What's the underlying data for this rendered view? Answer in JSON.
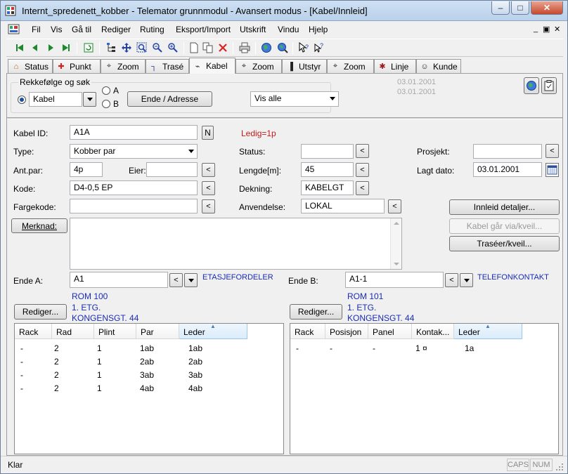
{
  "window": {
    "title": "Internt_spredenett_kobber - Telemator grunnmodul - Avansert modus - [Kabel/Innleid]",
    "min": "–",
    "max": "□",
    "close": "✕"
  },
  "menu": {
    "items": [
      "Fil",
      "Vis",
      "Gå til",
      "Rediger",
      "Ruting",
      "Eksport/Import",
      "Utskrift",
      "Vindu",
      "Hjelp"
    ],
    "mdi": {
      "min": "_",
      "restore": "▣",
      "close": "✕"
    }
  },
  "tabs": [
    {
      "label": "Status",
      "icon": "home-icon",
      "glyph": "⌂",
      "color": "#b06a00"
    },
    {
      "label": "Punkt",
      "icon": "cross-point-icon",
      "glyph": "✚",
      "color": "#cc2222"
    },
    {
      "label": "Zoom",
      "icon": "zoom-point-icon",
      "glyph": "⌖",
      "color": "#444444"
    },
    {
      "label": "Trasé",
      "icon": "route-icon",
      "glyph": "┐",
      "color": "#1b2f8a"
    },
    {
      "label": "Kabel",
      "icon": "cable-icon",
      "glyph": "⌁",
      "color": "#333333"
    },
    {
      "label": "Zoom",
      "icon": "zoom-cable-icon",
      "glyph": "⌖",
      "color": "#333333"
    },
    {
      "label": "Utstyr",
      "icon": "equipment-icon",
      "glyph": "▐",
      "color": "#222222"
    },
    {
      "label": "Zoom",
      "icon": "zoom-equipment-icon",
      "glyph": "⌖",
      "color": "#333333"
    },
    {
      "label": "Linje",
      "icon": "line-icon",
      "glyph": "✱",
      "color": "#a01818"
    },
    {
      "label": "Kunde",
      "icon": "customer-icon",
      "glyph": "☺",
      "color": "#222222"
    }
  ],
  "search": {
    "group_label": "Rekkefølge og søk",
    "order_value": "Kabel",
    "radio_a": "A",
    "radio_b": "B",
    "end_address_button": "Ende / Adresse",
    "filter_value": "Vis alle",
    "date1": "03.01.2001",
    "date2": "03.01.2001"
  },
  "form": {
    "kabel_id_label": "Kabel ID:",
    "kabel_id": "A1A",
    "n_button": "N",
    "ledig": "Ledig=1p",
    "type_label": "Type:",
    "type_value": "Kobber par",
    "status_label": "Status:",
    "status_value": "",
    "prosjekt_label": "Prosjekt:",
    "prosjekt_value": "",
    "antpar_label": "Ant.par:",
    "antpar_value": "4p",
    "eier_label": "Eier:",
    "eier_value": "",
    "lengde_label": "Lengde[m]:",
    "lengde_value": "45",
    "lagt_dato_label": "Lagt dato:",
    "lagt_dato_value": "03.01.2001",
    "kode_label": "Kode:",
    "kode_value": "D4-0,5 EP",
    "dekning_label": "Dekning:",
    "dekning_value": "KABELGT",
    "fargekode_label": "Fargekode:",
    "fargekode_value": "",
    "anvendelse_label": "Anvendelse:",
    "anvendelse_value": "LOKAL",
    "innleid_button": "Innleid detaljer...",
    "merknad_button": "Merknad:",
    "merknad_value": "",
    "kabel_via_button": "Kabel går via/kveil...",
    "traseer_button": "Traséer/kveil...",
    "arrow": "<"
  },
  "ende_a": {
    "label": "Ende A:",
    "value": "A1",
    "type": "ETASJEFORDELER",
    "addr": [
      "ROM 100",
      "1. ETG.",
      "KONGENSGT. 44"
    ],
    "edit_button": "Rediger...",
    "columns": [
      "Rack",
      "Rad",
      "Plint",
      "Par",
      "Leder"
    ],
    "rows": [
      [
        "-",
        "2",
        "1",
        "1ab",
        "1ab"
      ],
      [
        "-",
        "2",
        "1",
        "2ab",
        "2ab"
      ],
      [
        "-",
        "2",
        "1",
        "3ab",
        "3ab"
      ],
      [
        "-",
        "2",
        "1",
        "4ab",
        "4ab"
      ]
    ]
  },
  "ende_b": {
    "label": "Ende B:",
    "value": "A1-1",
    "type": "TELEFONKONTAKT",
    "addr": [
      "ROM 101",
      "1. ETG.",
      "KONGENSGT. 44"
    ],
    "edit_button": "Rediger...",
    "columns": [
      "Rack",
      "Posisjon",
      "Panel",
      "Kontak...",
      "Leder"
    ],
    "rows": [
      [
        "-",
        "-",
        "-",
        "1 ¤",
        "1a"
      ]
    ]
  },
  "status": {
    "text": "Klar",
    "caps": "CAPS",
    "num": "NUM"
  }
}
